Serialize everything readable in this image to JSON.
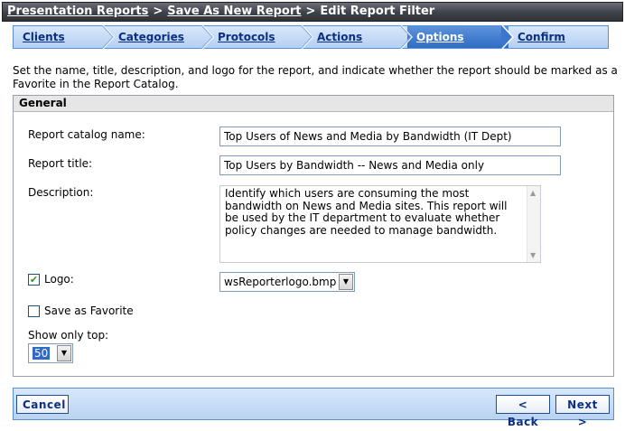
{
  "breadcrumb": {
    "items": [
      "Presentation Reports",
      "Save As New Report"
    ],
    "separator": ">",
    "current": "Edit Report Filter"
  },
  "steps": [
    {
      "label": "Clients"
    },
    {
      "label": "Categories"
    },
    {
      "label": "Protocols"
    },
    {
      "label": "Actions"
    },
    {
      "label": "Options",
      "active": true
    },
    {
      "label": "Confirm"
    }
  ],
  "intro": "Set the name, title, description, and logo for the report, and indicate whether the report should be marked as a Favorite in the Report Catalog.",
  "panel": {
    "title": "General",
    "catalog_name_label": "Report catalog name:",
    "catalog_name_value": "Top Users of News and Media by Bandwidth (IT Dept)",
    "title_label": "Report title:",
    "title_value": "Top Users by Bandwidth -- News and Media only",
    "description_label": "Description:",
    "description_value": "Identify which users are consuming the most bandwidth on News and Media sites. This report will be used by the IT department to evaluate whether policy changes are needed to manage bandwidth.",
    "logo_label": "Logo:",
    "logo_checked": true,
    "logo_value": "wsReporterlogo.bmp",
    "favorite_label": "Save as Favorite",
    "favorite_checked": false,
    "show_top_label": "Show only top:",
    "show_top_value": "50"
  },
  "footer": {
    "cancel_label": "Cancel",
    "back_label": "< Back",
    "next_label": "Next >"
  },
  "colors": {
    "accent": "#2f6cc4",
    "link": "#0b2f82",
    "titlebar": "#3f424a"
  }
}
